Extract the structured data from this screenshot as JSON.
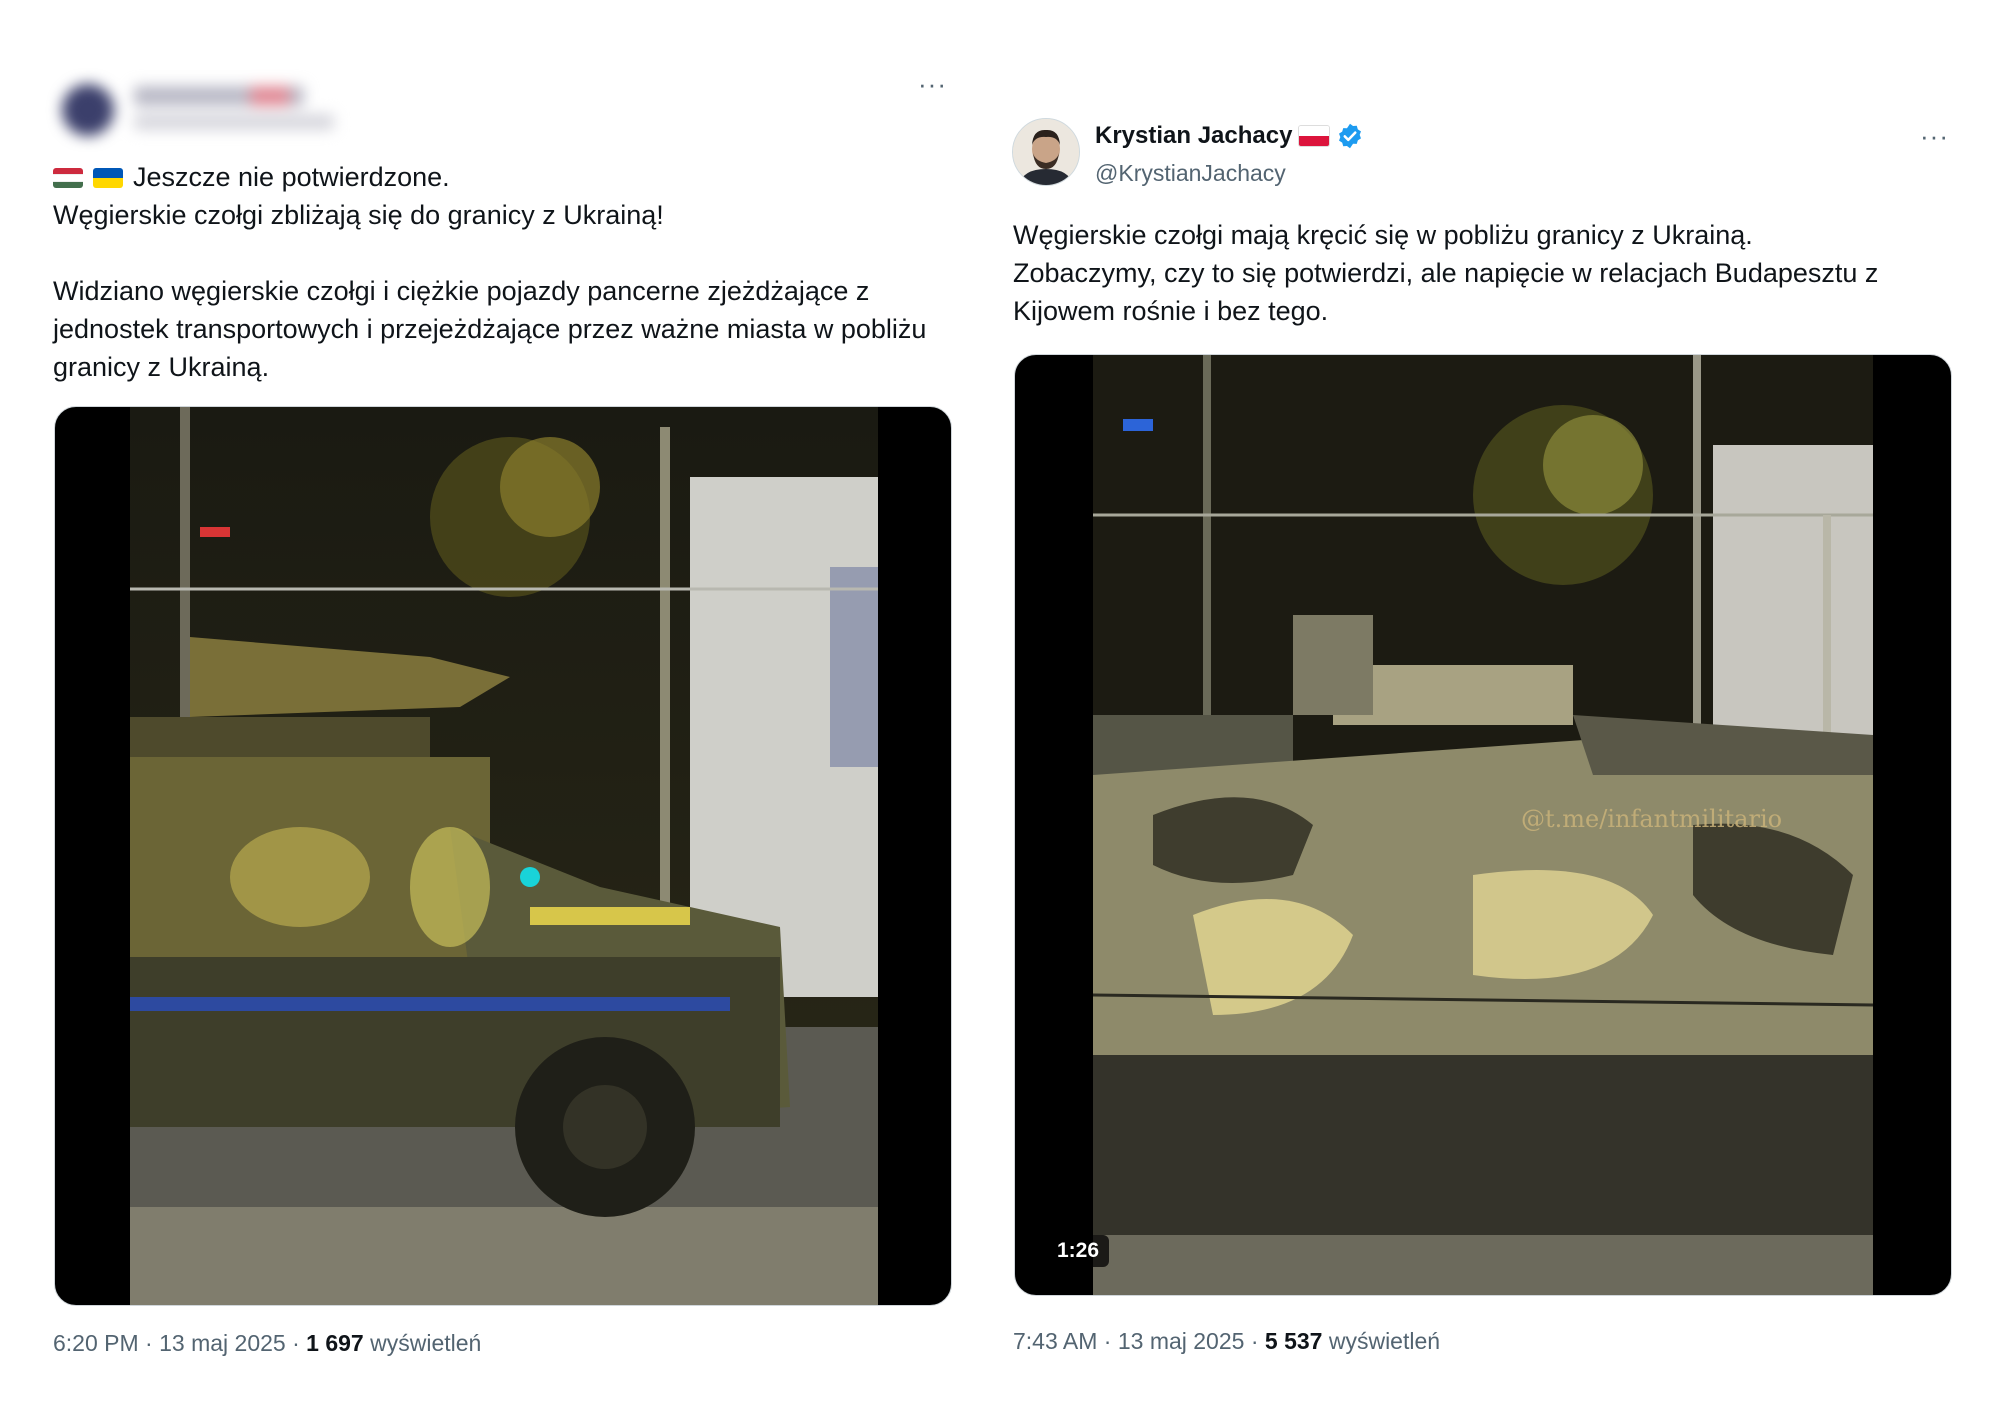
{
  "tweet_left": {
    "more_label": "···",
    "flags": [
      "hungary-flag",
      "ukraine-flag"
    ],
    "line1": "Jeszcze nie potwierdzone.",
    "line2": "Węgierskie czołgi zbliżają się do granicy z Ukrainą!",
    "body": "Widziano węgierskie czołgi i ciężkie pojazdy pancerne zjeżdżające z\njednostek transportowych i przejeżdżające przez ważne miasta w pobliżu\ngranicy z Ukrainą.",
    "time": "6:20 PM",
    "date": "13 maj 2025",
    "views": "1 697",
    "views_label": "wyświetleń"
  },
  "tweet_right": {
    "author_name": "Krystian Jachacy",
    "author_handle": "@KrystianJachacy",
    "more_label": "···",
    "body": "Węgierskie czołgi mają kręcić się w pobliżu granicy z Ukrainą.\nZobaczymy, czy to się potwierdzi, ale napięcie w relacjach Budapesztu z\nKijowem rośnie i bez tego.",
    "video_duration": "1:26",
    "watermark": "@t.me/infantmilitario",
    "time": "7:43 AM",
    "date": "13 maj 2025",
    "views": "5 537",
    "views_label": "wyświetleń"
  },
  "separator": " · ",
  "colors": {
    "text_primary": "#0f1419",
    "text_secondary": "#536471",
    "verified_blue": "#1d9bf0",
    "hungary": [
      "#cd2a3e",
      "#ffffff",
      "#436f4d"
    ],
    "ukraine": [
      "#0057b7",
      "#ffd700"
    ],
    "poland": [
      "#ffffff",
      "#dc143c"
    ]
  }
}
